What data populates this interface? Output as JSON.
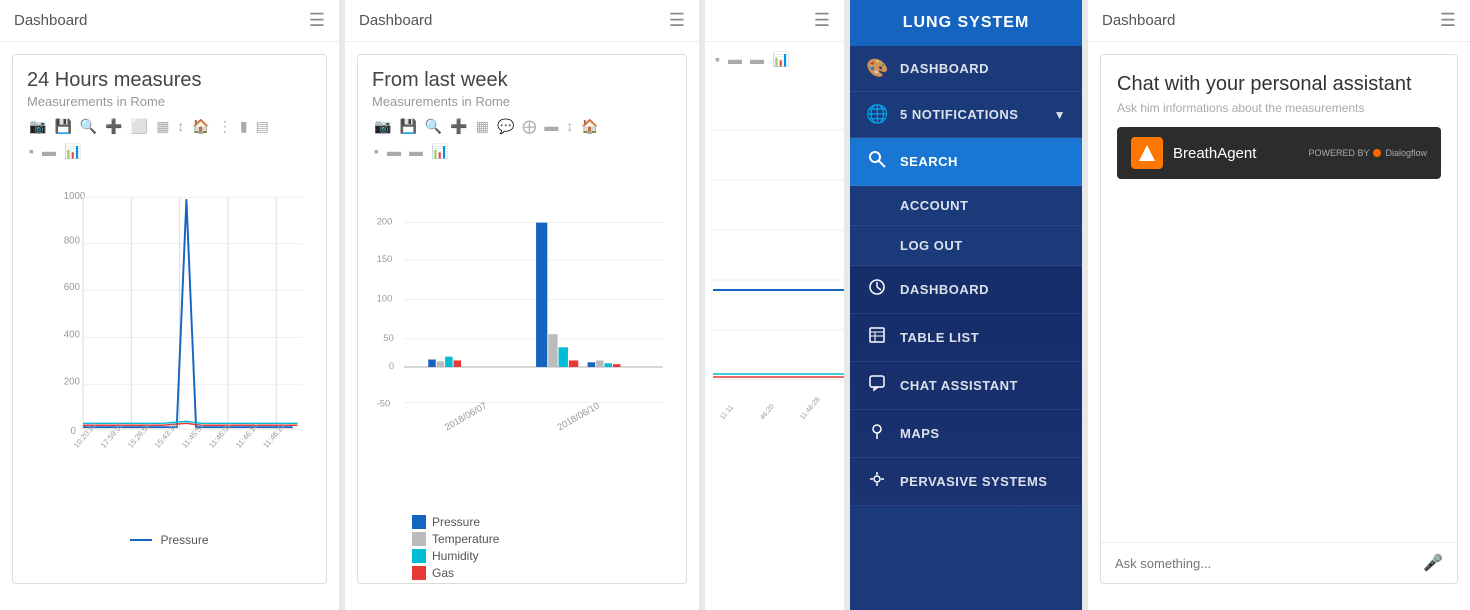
{
  "panel1": {
    "title": "Dashboard",
    "card": {
      "title": "24 Hours measures",
      "subtitle": "Measurements in Rome",
      "legend_label": "Pressure",
      "toolbar": [
        "📷",
        "💾",
        "🔍",
        "➕",
        "⬜",
        "⬜",
        "⬜",
        "⬜",
        "⬜",
        "⬜",
        "⬜",
        "⬜",
        "⬜",
        "⬜",
        "⬜",
        "⬜"
      ]
    }
  },
  "panel2": {
    "title": "Dashboard",
    "card": {
      "title": "From last week",
      "subtitle": "Measurements in Rome",
      "legend": [
        {
          "label": "Pressure",
          "color": "#1565c0"
        },
        {
          "label": "Temperature",
          "color": "#bbb"
        },
        {
          "label": "Humidity",
          "color": "#00bcd4"
        },
        {
          "label": "Gas",
          "color": "#e53935"
        }
      ]
    }
  },
  "panel4": {
    "title": "LUNG SYSTEM",
    "nav_top": [
      {
        "label": "DASHBOARD",
        "icon": "🎨",
        "active": false
      },
      {
        "label": "5 NOTIFICATIONS",
        "icon": "🌐",
        "active": false,
        "arrow": true
      },
      {
        "label": "SEARCH",
        "icon": "🔍",
        "active": true
      },
      {
        "label": "ACCOUNT",
        "icon": "",
        "active": false
      },
      {
        "label": "LOG OUT",
        "icon": "",
        "active": false
      }
    ],
    "nav_bottom": [
      {
        "label": "DASHBOARD",
        "icon": "⏱"
      },
      {
        "label": "TABLE LIST",
        "icon": "📋"
      },
      {
        "label": "CHAT ASSISTANT",
        "icon": "💬"
      },
      {
        "label": "MAPS",
        "icon": "📍"
      },
      {
        "label": "PERVASIVE SYSTEMS",
        "icon": "🔔"
      }
    ]
  },
  "panel5": {
    "title": "Dashboard",
    "card": {
      "title": "Chat with your personal assistant",
      "subtitle": "Ask him informations about the measurements",
      "agent_name": "BreathAgent",
      "powered_by": "POWERED BY",
      "dialogflow": "Dialogflow",
      "input_placeholder": "Ask something..."
    }
  }
}
